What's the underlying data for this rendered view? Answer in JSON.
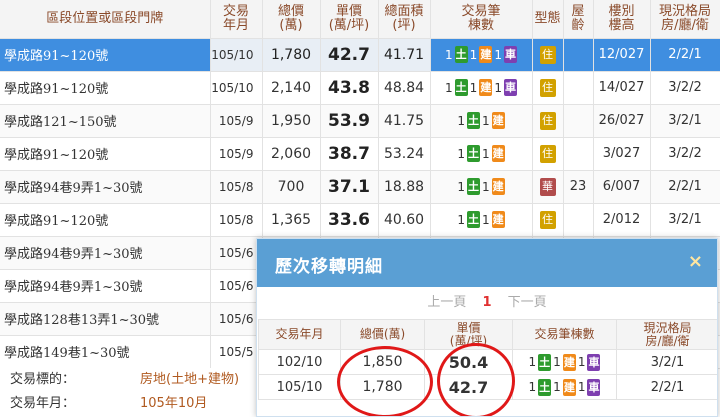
{
  "headers": {
    "address": "區段位置或區段門牌",
    "ym": "交易年月",
    "total": "總價(萬)",
    "unit": "單價(萬/坪)",
    "area": "總面積(坪)",
    "counts": "交易筆棟數",
    "type": "型態",
    "age": "屋齡",
    "floor": "樓別樓高",
    "layout": "現況格局房/廳/衛"
  },
  "rows": [
    {
      "address": "學成路91~120號",
      "ym": "105/10",
      "total": "1,780",
      "unit": "42.7",
      "area": "41.71",
      "land": "1",
      "bld": "1",
      "car": "1",
      "type": "住",
      "age": "",
      "floor": "12/027",
      "layout": "2/2/1",
      "selected": true
    },
    {
      "address": "學成路91~120號",
      "ym": "105/10",
      "total": "2,140",
      "unit": "43.8",
      "area": "48.84",
      "land": "1",
      "bld": "1",
      "car": "1",
      "type": "住",
      "age": "",
      "floor": "14/027",
      "layout": "3/2/2"
    },
    {
      "address": "學成路121~150號",
      "ym": "105/9",
      "total": "1,950",
      "unit": "53.9",
      "area": "41.75",
      "land": "1",
      "bld": "1",
      "car": "",
      "type": "住",
      "age": "",
      "floor": "26/027",
      "layout": "3/2/1"
    },
    {
      "address": "學成路91~120號",
      "ym": "105/9",
      "total": "2,060",
      "unit": "38.7",
      "area": "53.24",
      "land": "1",
      "bld": "1",
      "car": "",
      "type": "住",
      "age": "",
      "floor": "3/027",
      "layout": "3/2/2"
    },
    {
      "address": "學成路94巷9弄1~30號",
      "ym": "105/8",
      "total": "700",
      "unit": "37.1",
      "area": "18.88",
      "land": "1",
      "bld": "1",
      "car": "",
      "type": "華",
      "age": "23",
      "floor": "6/007",
      "layout": "2/2/1"
    },
    {
      "address": "學成路91~120號",
      "ym": "105/8",
      "total": "1,365",
      "unit": "33.6",
      "area": "40.60",
      "land": "1",
      "bld": "1",
      "car": "",
      "type": "住",
      "age": "",
      "floor": "2/012",
      "layout": "3/2/1"
    },
    {
      "address": "學成路94巷9弄1~30號",
      "ym": "105/6"
    },
    {
      "address": "學成路94巷9弄1~30號",
      "ym": "105/6"
    },
    {
      "address": "學成路128巷13弄1~30號",
      "ym": "105/6"
    },
    {
      "address": "學成路149巷1~30號",
      "ym": "105/5"
    }
  ],
  "badges": {
    "land": "土",
    "bld": "建",
    "car": "車"
  },
  "details": {
    "label1": "交易標的：",
    "value1": "房地(土地+建物)",
    "label2": "交易年月：",
    "value2": "105年10月"
  },
  "popup": {
    "title": "歷次移轉明細",
    "close": "×",
    "prev": "上一頁",
    "page": "1",
    "next": "下一頁",
    "headers": {
      "ym": "交易年月",
      "total": "總價(萬)",
      "unit": "單價(萬/坪)",
      "counts": "交易筆棟數",
      "layout": "現況格局房/廳/衛"
    },
    "rows": [
      {
        "ym": "102/10",
        "total": "1,850",
        "unit": "50.4",
        "land": "1",
        "bld": "1",
        "car": "1",
        "layout": "3/2/1"
      },
      {
        "ym": "105/10",
        "total": "1,780",
        "unit": "42.7",
        "land": "1",
        "bld": "1",
        "car": "1",
        "layout": "2/2/1"
      }
    ]
  },
  "colors": {
    "selected_row": "#3f8ee0",
    "popup_header": "#5a9fd4",
    "land_badge": "#2e9b2e",
    "building_badge": "#f08a1a",
    "car_badge": "#7e3fb0",
    "annotation_circle": "#e01818"
  }
}
